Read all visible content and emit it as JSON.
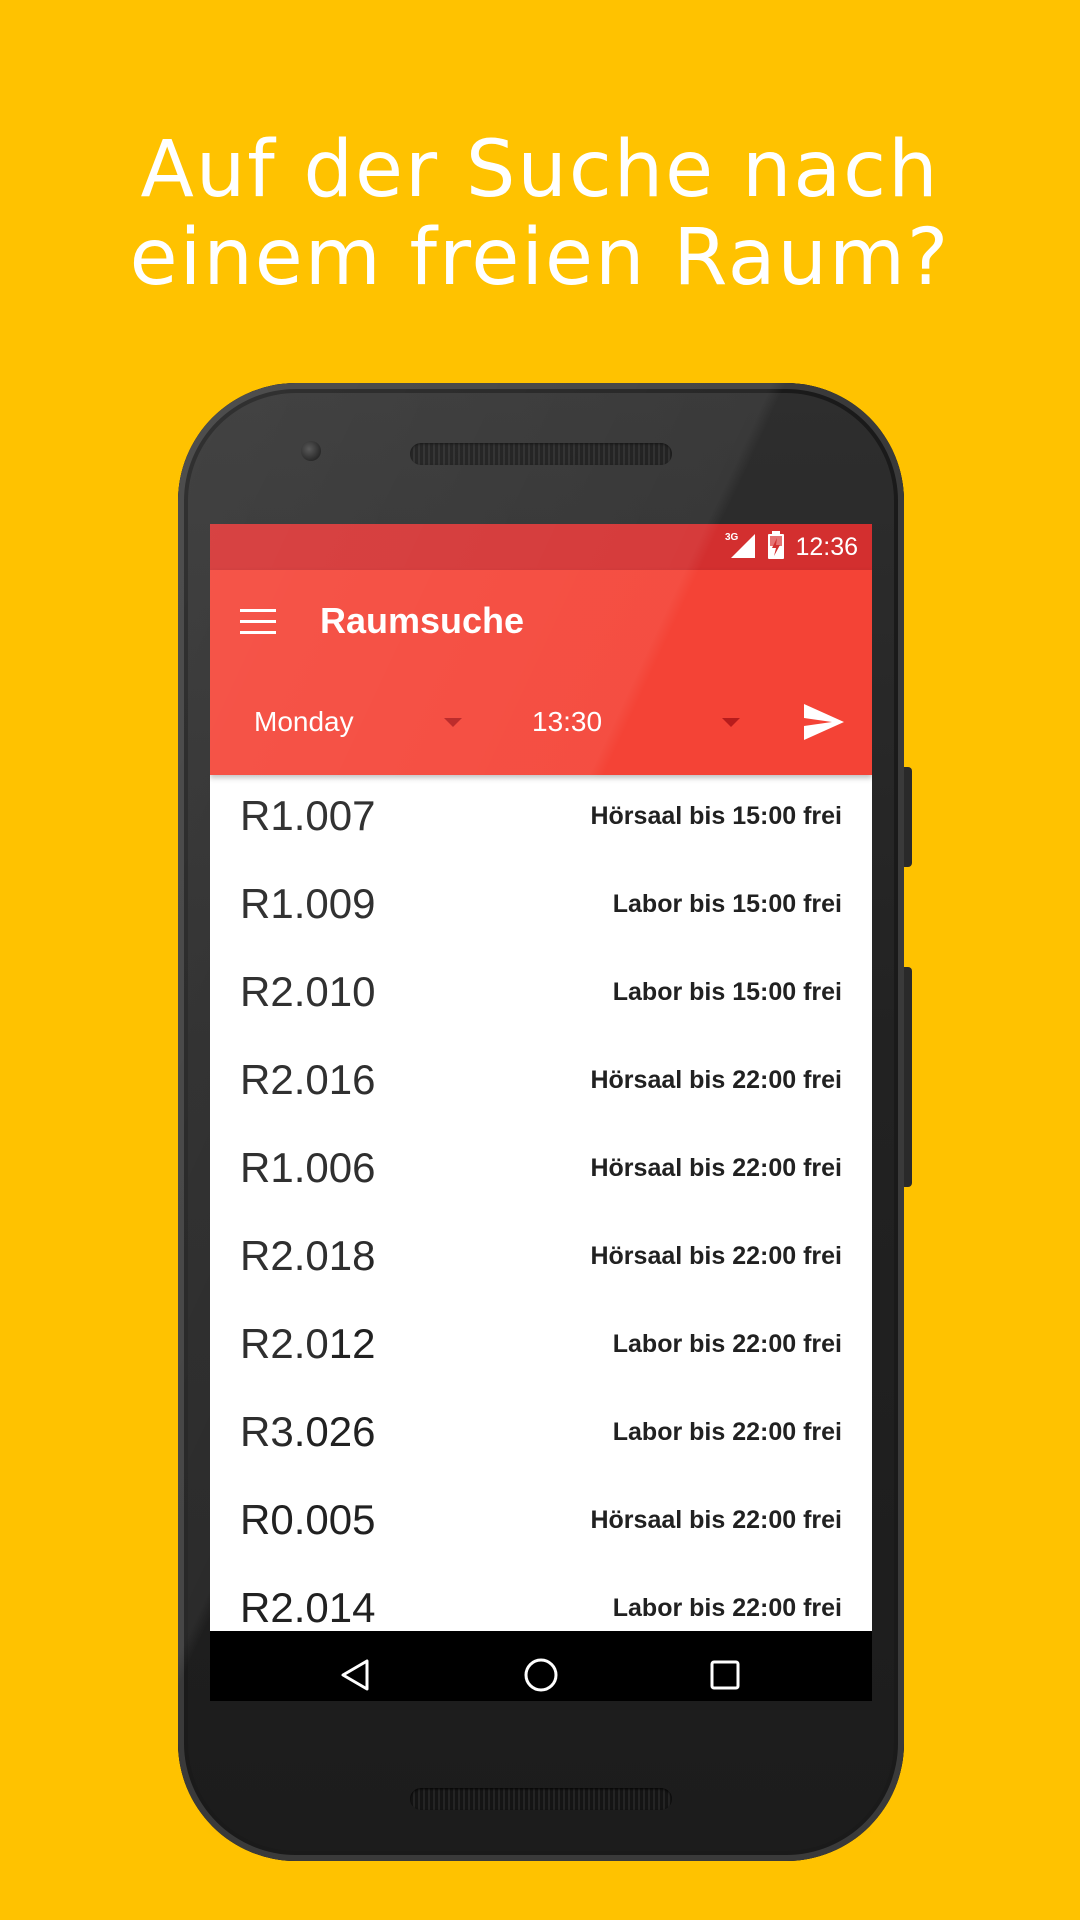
{
  "headline": {
    "line1": "Auf der Suche nach",
    "line2": "einem freien Raum?"
  },
  "status_bar": {
    "network": "3G",
    "time": "12:36"
  },
  "toolbar": {
    "title": "Raumsuche",
    "menu_icon": "hamburger-menu-icon",
    "day_value": "Monday",
    "time_value": "13:30",
    "send_icon": "send-icon"
  },
  "rooms": [
    {
      "name": "R1.007",
      "info": "Hörsaal bis 15:00 frei"
    },
    {
      "name": "R1.009",
      "info": "Labor bis 15:00 frei"
    },
    {
      "name": "R2.010",
      "info": "Labor bis 15:00 frei"
    },
    {
      "name": "R2.016",
      "info": "Hörsaal bis 22:00 frei"
    },
    {
      "name": "R1.006",
      "info": "Hörsaal bis 22:00 frei"
    },
    {
      "name": "R2.018",
      "info": "Hörsaal bis 22:00 frei"
    },
    {
      "name": "R2.012",
      "info": "Labor bis 22:00 frei"
    },
    {
      "name": "R3.026",
      "info": "Labor bis 22:00 frei"
    },
    {
      "name": "R0.005",
      "info": "Hörsaal bis 22:00 frei"
    },
    {
      "name": "R2.014",
      "info": "Labor bis 22:00 frei"
    }
  ],
  "nav_bar": {
    "back_icon": "back-icon",
    "home_icon": "home-icon",
    "recents_icon": "recents-icon"
  },
  "colors": {
    "background": "#ffc200",
    "status_bar": "#d32f2f",
    "toolbar": "#f44336",
    "text_primary": "#212121"
  }
}
